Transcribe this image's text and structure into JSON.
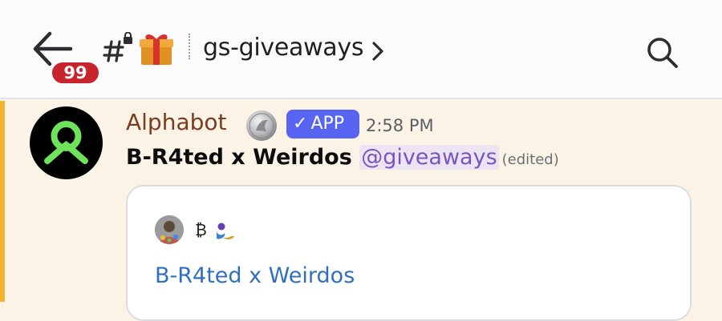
{
  "header": {
    "unread_count": "99",
    "channel_name": "gs-giveaways"
  },
  "message": {
    "author": "Alphabot",
    "app_tag": "APP",
    "timestamp": "2:58 PM",
    "text": "B-R4ted x Weirdos",
    "mention": "@giveaways",
    "edited_label": "(edited)"
  },
  "embed": {
    "author_name": "₿",
    "title": "B-R4ted x Weirdos"
  },
  "colors": {
    "accent_bar": "#f0b232",
    "app_badge": "#5865f2",
    "unread_badge": "#c8242d",
    "link": "#2f6fbf",
    "mention": "#7b54c2"
  },
  "icons": {
    "back": "arrow-left-icon",
    "channel": "hash-lock-icon",
    "emoji": "gift-icon",
    "chevron": "chevron-right-icon",
    "search": "search-icon"
  }
}
